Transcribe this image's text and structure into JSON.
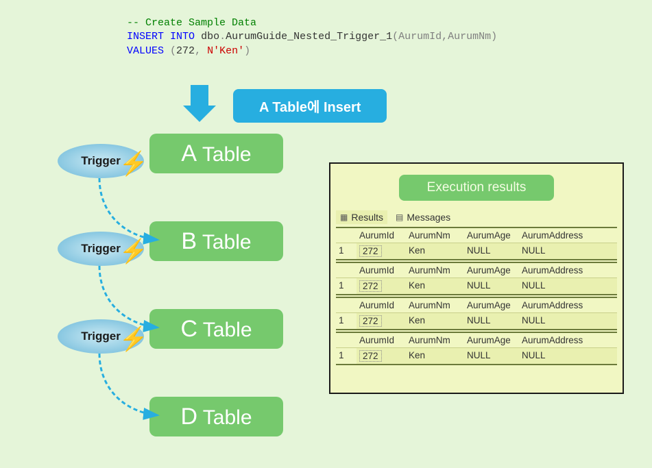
{
  "code": {
    "comment": "-- Create Sample Data",
    "kw_insert": "INSERT",
    "kw_into": "INTO",
    "schema": "dbo",
    "dot": ".",
    "table": "AurumGuide_Nested_Trigger_1",
    "cols": "(AurumId,AurumNm)",
    "kw_values": "VALUES",
    "open": "(",
    "num": "272",
    "comma": ", ",
    "nprefix": "N'Ken'",
    "close": ")"
  },
  "insert_badge": "A Table에 Insert",
  "tables": {
    "a": {
      "big": "A",
      "rest": " Table"
    },
    "b": {
      "big": "B",
      "rest": " Table"
    },
    "c": {
      "big": "C",
      "rest": " Table"
    },
    "d": {
      "big": "D",
      "rest": " Table"
    }
  },
  "trigger_label": "Trigger",
  "results": {
    "title": "Execution results",
    "tab_results": "Results",
    "tab_messages": "Messages",
    "columns": [
      "",
      "AurumId",
      "AurumNm",
      "AurumAge",
      "AurumAddress"
    ],
    "rows": [
      {
        "n": "1",
        "AurumId": "272",
        "AurumNm": "Ken",
        "AurumAge": "NULL",
        "AurumAddress": "NULL"
      },
      {
        "n": "1",
        "AurumId": "272",
        "AurumNm": "Ken",
        "AurumAge": "NULL",
        "AurumAddress": "NULL"
      },
      {
        "n": "1",
        "AurumId": "272",
        "AurumNm": "Ken",
        "AurumAge": "NULL",
        "AurumAddress": "NULL"
      },
      {
        "n": "1",
        "AurumId": "272",
        "AurumNm": "Ken",
        "AurumAge": "NULL",
        "AurumAddress": "NULL"
      }
    ]
  }
}
